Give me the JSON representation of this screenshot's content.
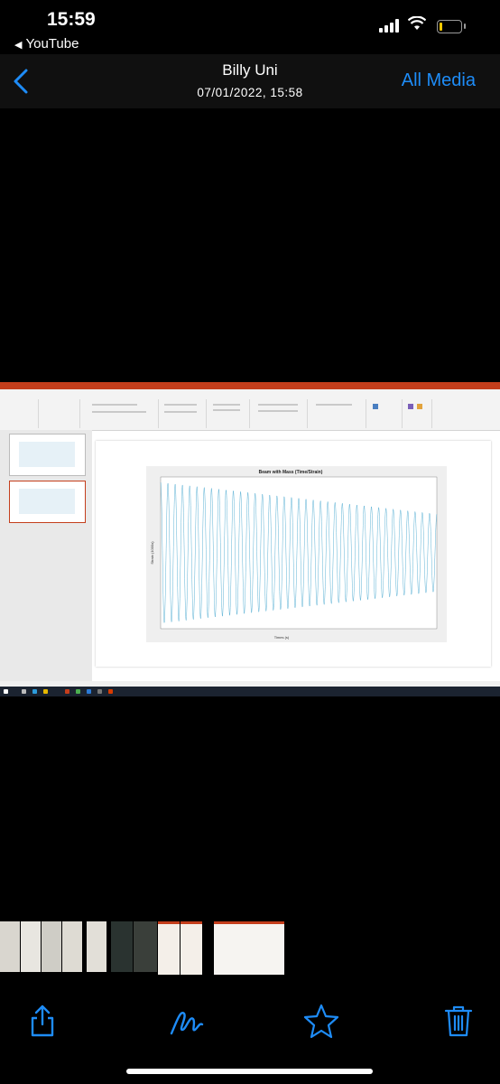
{
  "status_bar": {
    "time": "15:59",
    "back_app": "YouTube"
  },
  "nav": {
    "back_icon": "chevron-left-icon",
    "title": "Billy Uni",
    "subtitle": "07/01/2022, 15:58",
    "all_media": "All Media"
  },
  "chart_data": {
    "type": "line",
    "title": "Beam with Mass (Time/Strain)",
    "xlabel": "Times (s)",
    "ylabel": "Strain (1000x)",
    "series": [
      {
        "description": "damped sinusoid",
        "cycles": 38,
        "amplitude_start": 1.0,
        "amplitude_end": 0.55,
        "color": "#4aa8cf"
      }
    ]
  },
  "colors": {
    "accent": "#1e8cf7",
    "ppt_brand": "#c43e1c",
    "series": "#4aa8cf"
  },
  "toolbar": {
    "share": "share-icon",
    "markup": "markup-icon",
    "favorite": "star-icon",
    "delete": "trash-icon"
  }
}
